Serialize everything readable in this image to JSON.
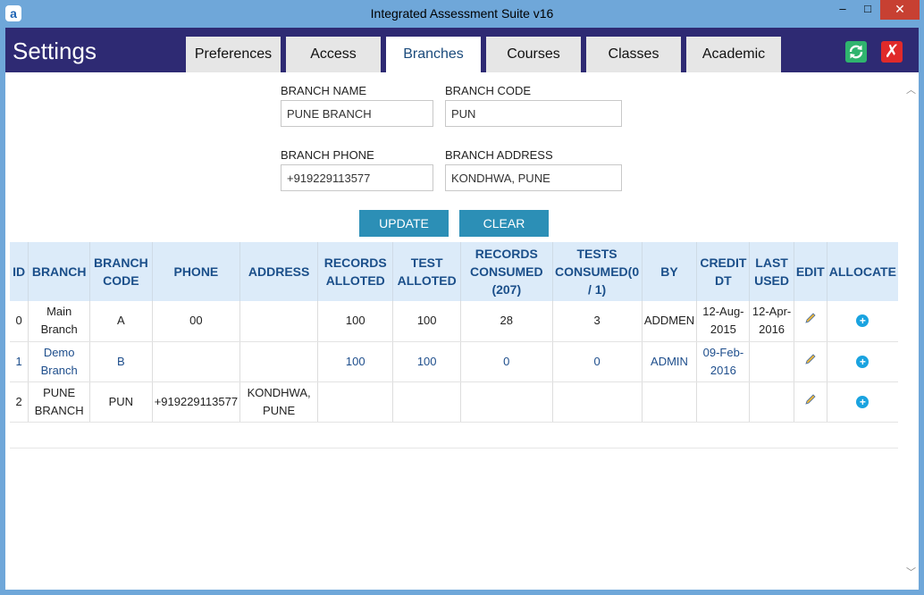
{
  "window": {
    "title": "Integrated Assessment Suite v16",
    "app_icon": "a",
    "minimize": "–",
    "maximize": "□",
    "close": "✕"
  },
  "header": {
    "title": "Settings",
    "tabs": [
      {
        "label": "Preferences"
      },
      {
        "label": "Access"
      },
      {
        "label": "Branches"
      },
      {
        "label": "Courses"
      },
      {
        "label": "Classes"
      },
      {
        "label": "Academic"
      }
    ],
    "active_tab": "Branches",
    "close_glyph": "✗"
  },
  "form": {
    "branch_name_label": "BRANCH NAME",
    "branch_name_value": "PUNE BRANCH",
    "branch_code_label": "BRANCH CODE",
    "branch_code_value": "PUN",
    "branch_phone_label": "BRANCH PHONE",
    "branch_phone_value": "+919229113577",
    "branch_address_label": "BRANCH ADDRESS",
    "branch_address_value": "KONDHWA, PUNE",
    "update_label": "UPDATE",
    "clear_label": "CLEAR"
  },
  "table": {
    "headers": [
      "ID",
      "BRANCH",
      "BRANCH CODE",
      "PHONE",
      "ADDRESS",
      "RECORDS ALLOTED",
      "TEST ALLOTED",
      "RECORDS CONSUMED (207)",
      "TESTS CONSUMED(0 / 1)",
      "BY",
      "CREDIT DT",
      "LAST USED",
      "EDIT",
      "ALLOCATE"
    ],
    "rows": [
      {
        "id": "0",
        "branch": "Main Branch",
        "code": "A",
        "phone": "00",
        "address": "",
        "records_alloted": "100",
        "test_alloted": "100",
        "records_consumed": "28",
        "tests_consumed": "3",
        "by": "ADDMEN",
        "credit_dt": "12-Aug-2015",
        "last_used": "12-Apr-2016"
      },
      {
        "id": "1",
        "branch": "Demo Branch",
        "code": "B",
        "phone": "",
        "address": "",
        "records_alloted": "100",
        "test_alloted": "100",
        "records_consumed": "0",
        "tests_consumed": "0",
        "by": "ADMIN",
        "credit_dt": "09-Feb-2016",
        "last_used": ""
      },
      {
        "id": "2",
        "branch": "PUNE BRANCH",
        "code": "PUN",
        "phone": "+919229113577",
        "address": "KONDHWA, PUNE",
        "records_alloted": "",
        "test_alloted": "",
        "records_consumed": "",
        "tests_consumed": "",
        "by": "",
        "credit_dt": "",
        "last_used": ""
      }
    ]
  },
  "colors": {
    "header_bg": "#2e2a73",
    "accent_button": "#2c8fb6",
    "table_header_bg": "#dcebf9",
    "window_frame": "#6fa7d9"
  },
  "icons": {
    "edit": "pencil-icon",
    "allocate": "plus-circle-icon",
    "refresh": "refresh-icon",
    "close": "close-icon"
  }
}
